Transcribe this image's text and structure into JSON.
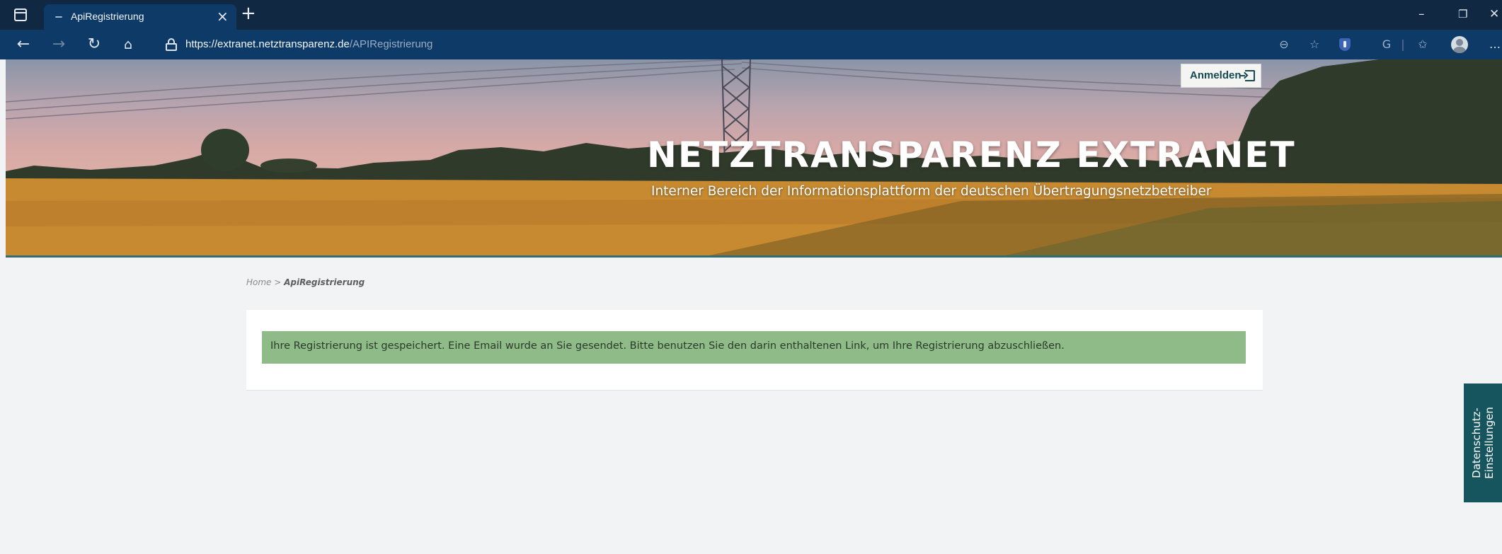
{
  "browser": {
    "tab_title": "ApiRegistrierung",
    "tab_close": "×",
    "new_tab": "+",
    "window_controls": {
      "minimize": "–",
      "maximize": "❐",
      "close": "✕"
    },
    "url_host": "https://extranet.netztransparenz.de",
    "url_path": "/APIRegistrierung",
    "icons": [
      "tab-actions-icon",
      "back-icon",
      "forward-icon",
      "refresh-icon",
      "home-icon",
      "lock-icon",
      "zoom-icon",
      "read-aloud-icon",
      "extension-shield-icon",
      "copilot-icon",
      "favorites-icon",
      "profile-icon",
      "more-icon"
    ]
  },
  "header": {
    "login_label": "Anmelden",
    "title": "NETZTRANSPARENZ EXTRANET",
    "subtitle": "Interner Bereich der Informationsplattform der deutschen Übertragungsnetzbetreiber"
  },
  "breadcrumb": {
    "home": "Home",
    "separator": " > ",
    "current": "ApiRegistrierung"
  },
  "alert": {
    "message": "Ihre Registrierung ist gespeichert. Eine Email wurde an Sie gesendet. Bitte benutzen Sie den darin enthaltenen Link, um Ihre Registrierung abzuschließen.",
    "color": "#8fbb88"
  },
  "privacy": {
    "label": "Datenschutz-\nEinstellungen",
    "color": "#16545e"
  },
  "colors": {
    "chrome_dark": "#102842",
    "chrome_bar": "#0e3a67",
    "page_bg": "#f2f3f5"
  }
}
